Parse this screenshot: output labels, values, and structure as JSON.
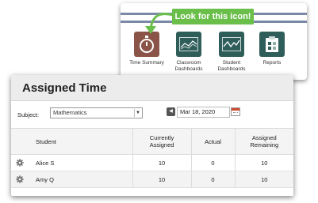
{
  "callout": {
    "banner": "Look for this icon!",
    "tiles": [
      {
        "label": "Time Summary",
        "icon": "stopwatch-icon",
        "color": "#8a5448"
      },
      {
        "label": "Classroom Dashboards",
        "icon": "line-chart-icon",
        "color": "#2f5d5a"
      },
      {
        "label": "Student Dashboards",
        "icon": "trend-chart-icon",
        "color": "#2f5d5a"
      },
      {
        "label": "Reports",
        "icon": "report-icon",
        "color": "#2f5d5a"
      }
    ],
    "banner_color": "#6abf4a"
  },
  "panel": {
    "title": "Assigned Time",
    "subject_label": "Subject:",
    "subject_value": "Mathematics",
    "date_value": "Mar 18, 2020"
  },
  "table": {
    "headers": {
      "student": "Student",
      "currently_assigned": "Currently Assigned",
      "actual": "Actual",
      "assigned_remaining": "Assigned Remaining"
    },
    "rows": [
      {
        "student": "Alice S",
        "currently_assigned": "10",
        "actual": "0",
        "assigned_remaining": "10"
      },
      {
        "student": "Amy Q",
        "currently_assigned": "10",
        "actual": "0",
        "assigned_remaining": "10"
      }
    ]
  }
}
